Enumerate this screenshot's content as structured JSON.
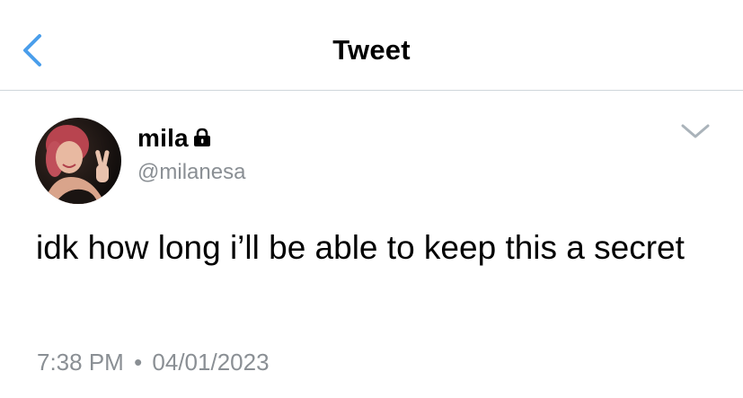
{
  "header": {
    "title": "Tweet",
    "back_icon": "chevron-left-icon",
    "accent_color": "#4a9eeb"
  },
  "tweet": {
    "author": {
      "display_name": "mila",
      "handle": "@milanesa",
      "protected_icon": "lock-icon",
      "avatar": "profile-photo"
    },
    "menu_icon": "chevron-down-icon",
    "text": "idk how long i’ll be able to keep this a secret",
    "time": "7:38 PM",
    "separator": "•",
    "date": "04/01/2023"
  }
}
